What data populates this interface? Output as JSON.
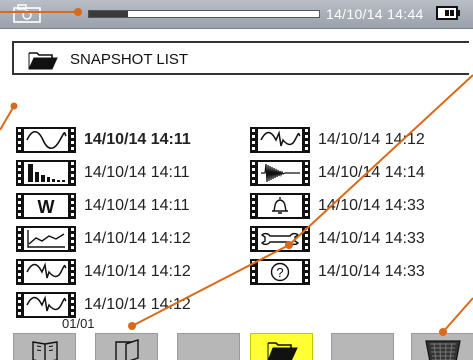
{
  "status_bar": {
    "datetime": "14/10/14 14:44",
    "progress": 0.17
  },
  "header": {
    "title": "SNAPSHOT LIST",
    "icon": "folder-open-icon"
  },
  "snapshots": [
    {
      "label": "14/10/14 14:11",
      "icon": "waveform-icon",
      "selected": true
    },
    {
      "label": "14/10/14 14:11",
      "icon": "harmonics-bars-icon",
      "selected": false
    },
    {
      "label": "14/10/14 14:11",
      "icon": "power-w-icon",
      "selected": false
    },
    {
      "label": "14/10/14 14:12",
      "icon": "trend-icon",
      "selected": false
    },
    {
      "label": "14/10/14 14:12",
      "icon": "transient-icon",
      "selected": false
    },
    {
      "label": "14/10/14 14:12",
      "icon": "transient-icon",
      "selected": false
    },
    {
      "label": "14/10/14 14:12",
      "icon": "transient-icon",
      "selected": false
    },
    {
      "label": "14/10/14 14:14",
      "icon": "inrush-icon",
      "selected": false
    },
    {
      "label": "14/10/14 14:33",
      "icon": "alarm-bell-icon",
      "selected": false
    },
    {
      "label": "14/10/14 14:33",
      "icon": "wrench-icon",
      "selected": false
    },
    {
      "label": "14/10/14 14:33",
      "icon": "help-icon",
      "selected": false
    }
  ],
  "page_indicator": "01/01",
  "bottom_buttons": [
    {
      "icon": "open-book-icon",
      "active": false
    },
    {
      "icon": "open-page-icon",
      "active": false
    },
    {
      "icon": "",
      "active": false
    },
    {
      "icon": "folder-open-icon",
      "active": true
    },
    {
      "icon": "",
      "active": false
    },
    {
      "icon": "trash-icon",
      "active": false
    }
  ],
  "colors": {
    "status_bar": "#a9afb8",
    "active_button": "#ffff33",
    "button": "#b7b7b7",
    "callout": "#d86a1a"
  }
}
